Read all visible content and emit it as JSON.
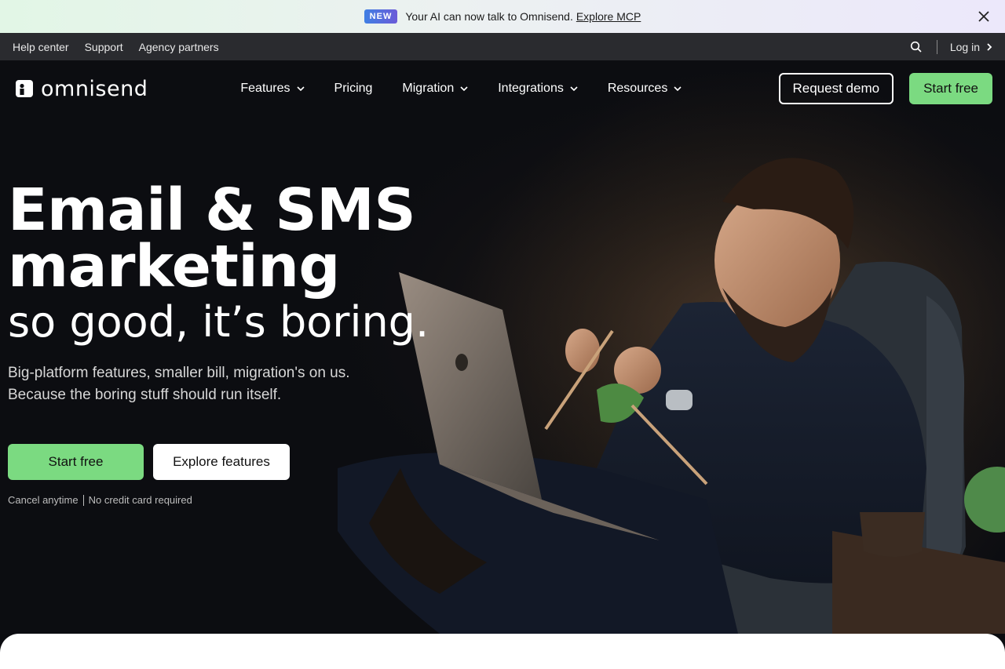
{
  "announcement": {
    "badge": "NEW",
    "text": "Your AI can now talk to Omnisend.",
    "link": "Explore MCP",
    "close_icon": "close-icon"
  },
  "utility": {
    "links": [
      "Help center",
      "Support",
      "Agency partners"
    ],
    "search_icon": "search-icon",
    "login": "Log in"
  },
  "nav": {
    "logo_text": "omnisend",
    "items": [
      {
        "label": "Features",
        "has_dropdown": true
      },
      {
        "label": "Pricing",
        "has_dropdown": false
      },
      {
        "label": "Migration",
        "has_dropdown": true
      },
      {
        "label": "Integrations",
        "has_dropdown": true
      },
      {
        "label": "Resources",
        "has_dropdown": true
      }
    ],
    "request_demo": "Request demo",
    "start_free": "Start free"
  },
  "hero": {
    "headline_line1": "Email & SMS",
    "headline_line2": "marketing",
    "subheadline": "so good, it’s boring.",
    "lead_line1": "Big-platform features, smaller bill, migration's on us.",
    "lead_line2": "Because the boring stuff should run itself.",
    "cta_primary": "Start free",
    "cta_secondary": "Explore features",
    "fine_print_1": "Cancel anytime",
    "fine_print_2": "No credit card required"
  },
  "colors": {
    "accent_green": "#7bda81",
    "dark_bg": "#0c0d11",
    "util_bar": "#2a2b2f"
  }
}
